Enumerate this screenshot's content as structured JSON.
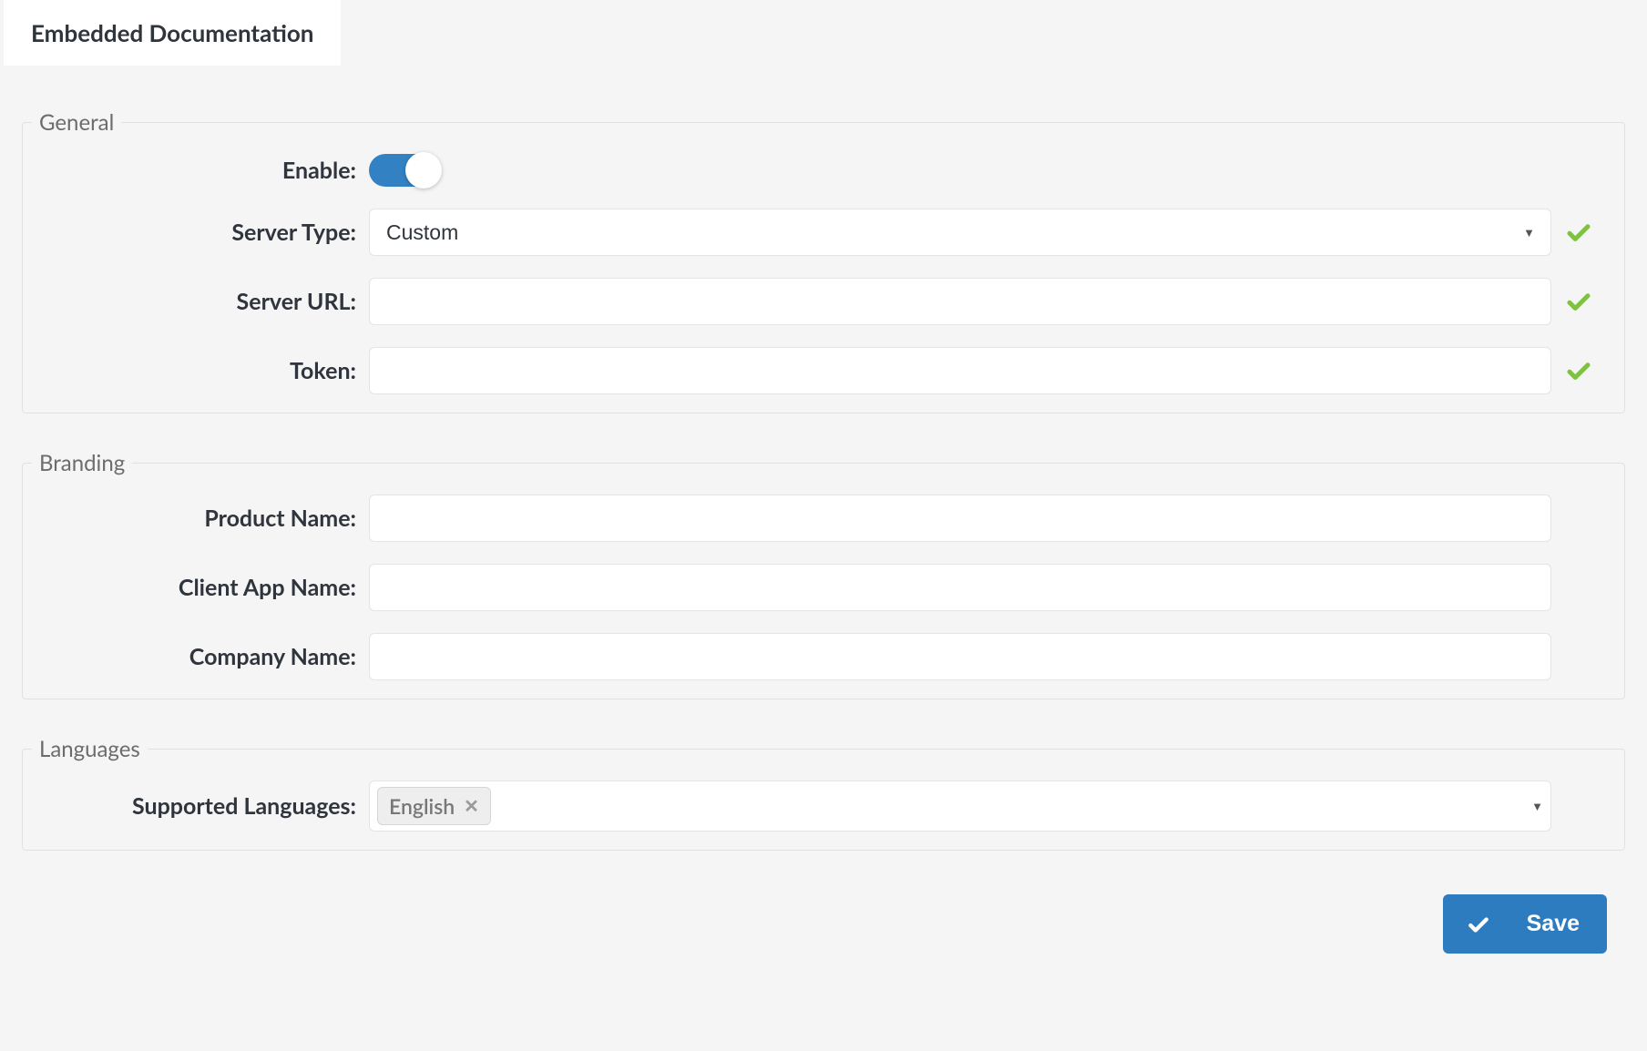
{
  "tab": {
    "label": "Embedded Documentation"
  },
  "sections": {
    "general": {
      "legend": "General",
      "enable": {
        "label": "Enable:",
        "on": true
      },
      "server_type": {
        "label": "Server Type:",
        "value": "Custom",
        "valid": true
      },
      "server_url": {
        "label": "Server URL:",
        "value": "",
        "valid": true
      },
      "token": {
        "label": "Token:",
        "value": "",
        "valid": true
      }
    },
    "branding": {
      "legend": "Branding",
      "product_name": {
        "label": "Product Name:",
        "value": ""
      },
      "client_app_name": {
        "label": "Client App Name:",
        "value": ""
      },
      "company_name": {
        "label": "Company Name:",
        "value": ""
      }
    },
    "languages": {
      "legend": "Languages",
      "supported": {
        "label": "Supported Languages:",
        "chips": [
          {
            "label": "English"
          }
        ]
      }
    }
  },
  "footer": {
    "save_label": "Save"
  }
}
